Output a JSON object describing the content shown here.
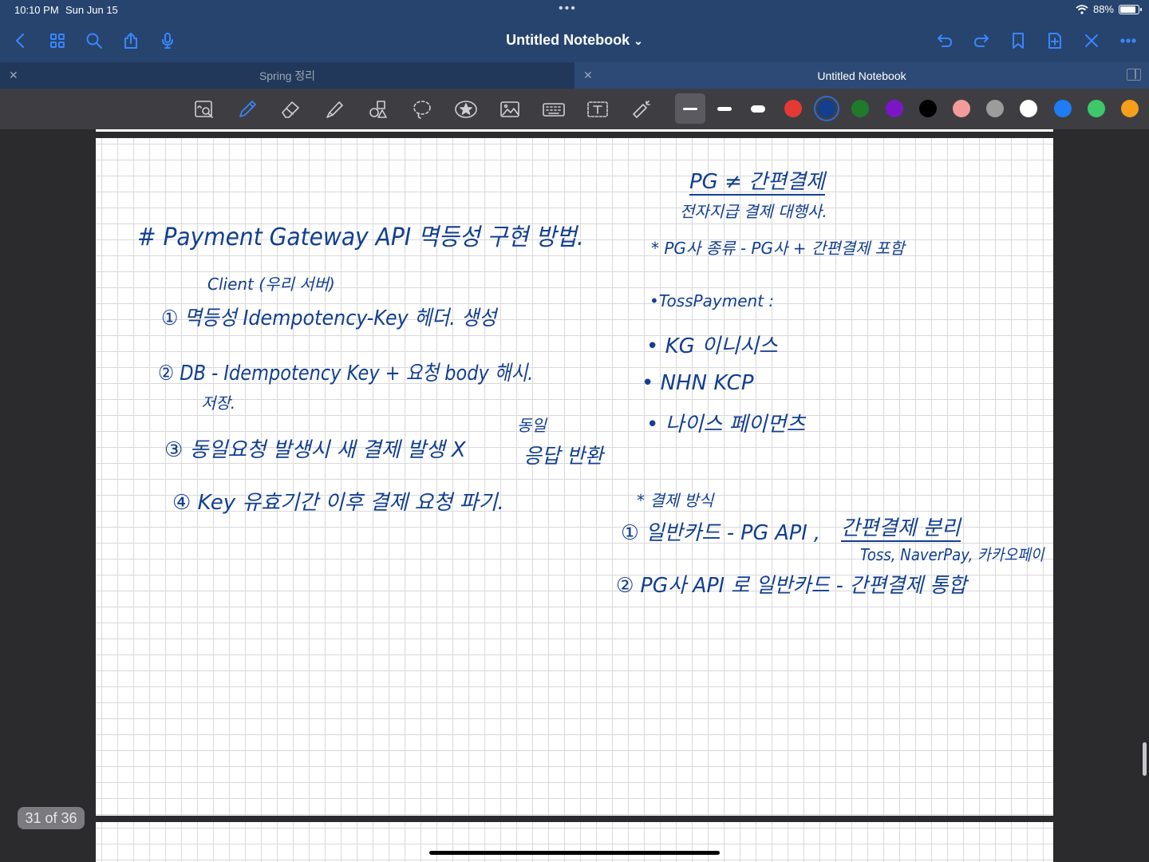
{
  "status": {
    "time": "10:10 PM",
    "date": "Sun Jun 15",
    "battery": "88%",
    "battery_level": 0.88
  },
  "nav": {
    "title": "Untitled Notebook",
    "title_chevron": "⌄"
  },
  "tabs": [
    {
      "label": "Spring 정리",
      "active": false
    },
    {
      "label": "Untitled Notebook",
      "active": true
    }
  ],
  "toolbar": {
    "tools": [
      "zoom-window-icon",
      "pen-icon",
      "eraser-icon",
      "highlighter-icon",
      "shapes-icon",
      "lasso-icon",
      "sticker-icon",
      "image-icon",
      "keyboard-icon",
      "text-box-icon",
      "laser-pointer-icon"
    ],
    "active_tool": "pen-icon",
    "stroke_widths": [
      "thin",
      "medium",
      "thick"
    ],
    "selected_stroke": "thin",
    "colors": [
      "#e53935",
      "#123f8f",
      "#1f7a2c",
      "#7b16c8",
      "#000000",
      "#f29b9b",
      "#9c9c9c",
      "#ffffff",
      "#1f7cf2",
      "#3cc86b",
      "#f59f1a"
    ],
    "selected_color": "#123f8f"
  },
  "notes": {
    "heading": "# Payment Gateway API 멱등성 구현 방법.",
    "step1_note": "Client (우리 서버)",
    "step1": "① 멱등성 Idempotency-Key 헤더. 생성",
    "step2": "② DB - Idempotency Key + 요청 body 해시.",
    "step2_cont": "저장.",
    "step3": "③ 동일요청 발생시   새 결제 발생 X",
    "step3_note": "동일",
    "step3_end": "응답 반환",
    "step4": "④ Key 유효기간 이후   결제 요청 파기.",
    "pg_title": "PG ≠ 간편결제",
    "pg_sub": "전자지급 결제 대행사.",
    "pg_types": "* PG사 종류 - PG사 + 간편결제 포함",
    "pg_list_title": "•TossPayment   :",
    "pg_list": [
      "• KG 이니시스",
      "• NHN   KCP",
      "• 나이스 페이먼츠"
    ],
    "method_title": "* 결제 방식",
    "method1": "① 일반카드 - PG API  ,",
    "method1_easy": "간편결제 분리",
    "method1_note": "Toss, NaverPay, 카카오페이",
    "method2": "② PG사 API 로   일반카드 - 간편결제 통합"
  },
  "page_counter": "31 of 36"
}
